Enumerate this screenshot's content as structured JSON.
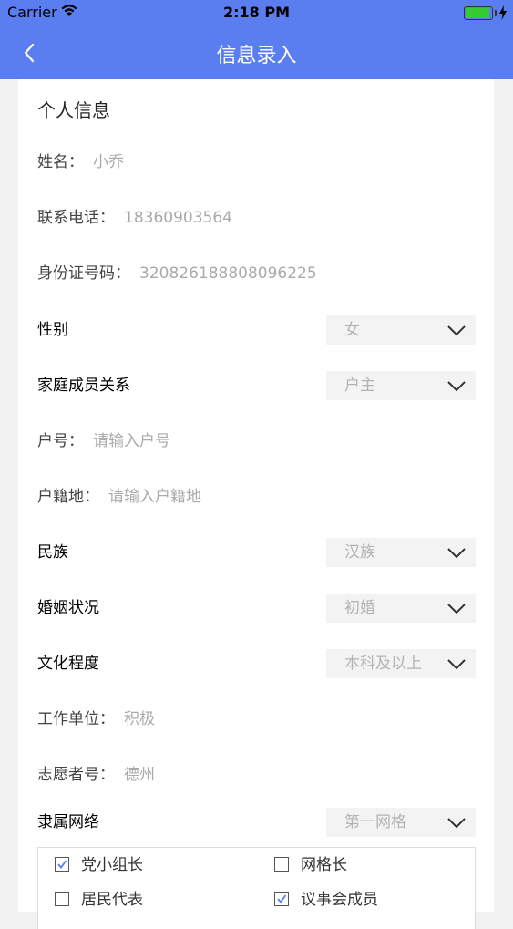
{
  "status_bar": {
    "carrier": "Carrier",
    "time": "2:18 PM"
  },
  "nav": {
    "title": "信息录入"
  },
  "section": {
    "title": "个人信息"
  },
  "fields": [
    {
      "label": "姓名：",
      "value": "小乔"
    },
    {
      "label": "联系电话：",
      "value": "18360903564"
    },
    {
      "label": "身份证号码：",
      "value": "320826188808096225"
    },
    {
      "label": "户号：",
      "value": "请输入户号"
    },
    {
      "label": "户籍地：",
      "value": "请输入户籍地"
    },
    {
      "label": "工作单位：",
      "value": "积极"
    },
    {
      "label": "志愿者号：",
      "value": "德州"
    }
  ],
  "selects": [
    {
      "label": "性别",
      "value": "女"
    },
    {
      "label": "家庭成员关系",
      "value": "户主"
    },
    {
      "label": "民族",
      "value": "汉族"
    },
    {
      "label": "婚姻状况",
      "value": "初婚"
    },
    {
      "label": "文化程度",
      "value": "本科及以上"
    },
    {
      "label": "隶属网络",
      "value": "第一网格"
    }
  ],
  "checkboxes": [
    {
      "label": "党小组长",
      "checked": true
    },
    {
      "label": "网格长",
      "checked": false
    },
    {
      "label": "居民代表",
      "checked": false
    },
    {
      "label": "议事会成员",
      "checked": true
    }
  ],
  "colors": {
    "primary": "#5a7ef0",
    "battery": "#33cc33"
  },
  "icons": {
    "back": "chevron-left-icon",
    "dropdown": "chevron-down-icon",
    "wifi": "wifi-icon",
    "battery": "battery-icon",
    "charging": "bolt-icon"
  }
}
